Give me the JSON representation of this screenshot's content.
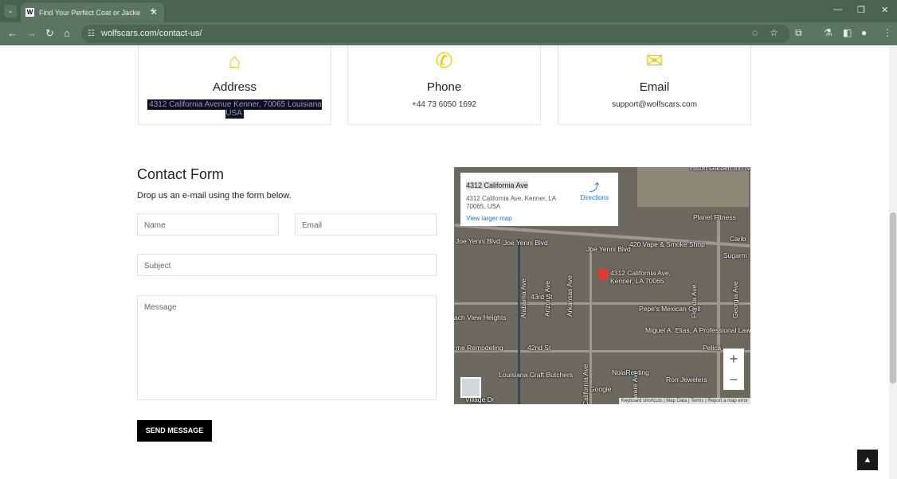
{
  "browser": {
    "tab_title": "Find Your Perfect Coat or Jacke",
    "favicon": "W",
    "url": "wolfscars.com/contact-us/"
  },
  "cards": [
    {
      "icon": "home-icon",
      "title": "Address",
      "text": "4312 California Avenue Kenner, 70065 Louisiana USA"
    },
    {
      "icon": "phone-icon",
      "title": "Phone",
      "text": "+44 73 6050 1692"
    },
    {
      "icon": "envelope-icon",
      "title": "Email",
      "text": "support@wolfscars.com"
    }
  ],
  "form": {
    "title": "Contact Form",
    "subtitle": "Drop us an e-mail using the form below.",
    "name_placeholder": "Name",
    "email_placeholder": "Email",
    "subject_placeholder": "Subject",
    "message_placeholder": "Message",
    "submit": "SEND MESSAGE"
  },
  "map": {
    "place": "4312 California Ave",
    "address": "4312 California Ave, Kenner, LA 70065, USA",
    "view_larger": "View larger map",
    "directions": "Directions",
    "pin_label": "4312 California Ave, Kenner, LA 70065",
    "labels": [
      "Hilton Garden Inn New Orleans Airp",
      "Planet Fitness",
      "Joe Yenni Blvd",
      "Joe Yenni Blvd",
      "Joe Yenni Blvd",
      "420 Vape & Smoke Shop",
      "Sugarm",
      "Carib",
      "Alabama Ave",
      "Arizona Ave",
      "Arkansas Ave",
      "43rd St",
      "Pepe's Mexican Grill",
      "Florida Ave",
      "Georgia Ave",
      "ach View Heights",
      "Miguel A. Elias, A Professional Law...",
      "me Remodeling",
      "42nd St",
      "California Ave",
      "Pelica",
      "Louisiana Craft Butchers",
      "NolaRenting",
      "Delaware Ave",
      "Ron Jewelers",
      "Village Dr",
      "Google"
    ],
    "attribution": "Keyboard shortcuts | Map Data | Terms | Report a map error"
  },
  "accent": "#f6c800"
}
